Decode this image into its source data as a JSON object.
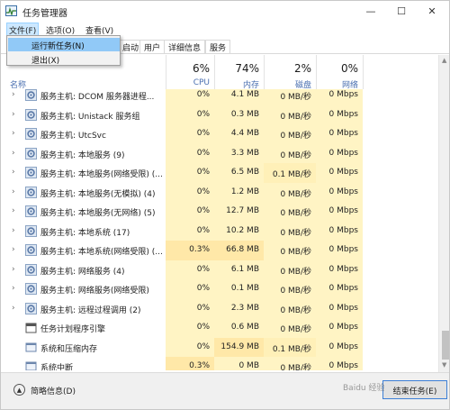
{
  "window": {
    "title": "任务管理器",
    "controls": {
      "minimize": "—",
      "maximize": "☐",
      "close": "✕"
    }
  },
  "menubar": {
    "file": "文件(F)",
    "options": "选项(O)",
    "view": "查看(V)"
  },
  "file_menu": {
    "items": [
      {
        "label": "运行新任务(N)",
        "highlighted": true
      },
      {
        "label": "退出(X)",
        "highlighted": false
      }
    ]
  },
  "tabs": [
    "启动",
    "用户",
    "详细信息",
    "服务"
  ],
  "columns": {
    "name": "名称",
    "cpu": {
      "pct": "6%",
      "label": "CPU"
    },
    "memory": {
      "pct": "74%",
      "label": "内存"
    },
    "disk": {
      "pct": "2%",
      "label": "磁盘"
    },
    "network": {
      "pct": "0%",
      "label": "网络"
    }
  },
  "rows": [
    {
      "name": "服务主机: DCOM 服务器进程...",
      "expand": true,
      "icon": "gear-icon",
      "cpu": "0%",
      "mem": "4.1 MB",
      "disk": "0 MB/秒",
      "net": "0 Mbps"
    },
    {
      "name": "服务主机: Unistack 服务组",
      "expand": true,
      "icon": "gear-icon",
      "cpu": "0%",
      "mem": "0.3 MB",
      "disk": "0 MB/秒",
      "net": "0 Mbps"
    },
    {
      "name": "服务主机: UtcSvc",
      "expand": true,
      "icon": "gear-icon",
      "cpu": "0%",
      "mem": "4.4 MB",
      "disk": "0 MB/秒",
      "net": "0 Mbps"
    },
    {
      "name": "服务主机: 本地服务 (9)",
      "expand": true,
      "icon": "gear-icon",
      "cpu": "0%",
      "mem": "3.3 MB",
      "disk": "0 MB/秒",
      "net": "0 Mbps"
    },
    {
      "name": "服务主机: 本地服务(网络受限) (...",
      "expand": true,
      "icon": "gear-icon",
      "cpu": "0%",
      "mem": "6.5 MB",
      "disk": "0.1 MB/秒",
      "net": "0 Mbps"
    },
    {
      "name": "服务主机: 本地服务(无模拟) (4)",
      "expand": true,
      "icon": "gear-icon",
      "cpu": "0%",
      "mem": "1.2 MB",
      "disk": "0 MB/秒",
      "net": "0 Mbps"
    },
    {
      "name": "服务主机: 本地服务(无网络) (5)",
      "expand": true,
      "icon": "gear-icon",
      "cpu": "0%",
      "mem": "12.7 MB",
      "disk": "0 MB/秒",
      "net": "0 Mbps"
    },
    {
      "name": "服务主机: 本地系统 (17)",
      "expand": true,
      "icon": "gear-icon",
      "cpu": "0%",
      "mem": "10.2 MB",
      "disk": "0 MB/秒",
      "net": "0 Mbps"
    },
    {
      "name": "服务主机: 本地系统(网络受限) (...",
      "expand": true,
      "icon": "gear-icon",
      "cpu": "0.3%",
      "mem": "66.8 MB",
      "disk": "0 MB/秒",
      "net": "0 Mbps"
    },
    {
      "name": "服务主机: 网络服务 (4)",
      "expand": true,
      "icon": "gear-icon",
      "cpu": "0%",
      "mem": "6.1 MB",
      "disk": "0 MB/秒",
      "net": "0 Mbps"
    },
    {
      "name": "服务主机: 网络服务(网络受限)",
      "expand": true,
      "icon": "gear-icon",
      "cpu": "0%",
      "mem": "0.1 MB",
      "disk": "0 MB/秒",
      "net": "0 Mbps"
    },
    {
      "name": "服务主机: 远程过程调用 (2)",
      "expand": true,
      "icon": "gear-icon",
      "cpu": "0%",
      "mem": "2.3 MB",
      "disk": "0 MB/秒",
      "net": "0 Mbps"
    },
    {
      "name": "任务计划程序引擎",
      "expand": false,
      "icon": "scheduler-icon",
      "cpu": "0%",
      "mem": "0.6 MB",
      "disk": "0 MB/秒",
      "net": "0 Mbps"
    },
    {
      "name": "系统和压缩内存",
      "expand": false,
      "icon": "window-icon",
      "cpu": "0%",
      "mem": "154.9 MB",
      "disk": "0.1 MB/秒",
      "net": "0 Mbps"
    },
    {
      "name": "系统中断",
      "expand": false,
      "icon": "window-icon",
      "cpu": "0.3%",
      "mem": "0 MB",
      "disk": "0 MB/秒",
      "net": "0 Mbps"
    }
  ],
  "footer": {
    "fewer_details": "简略信息(D)",
    "end_task": "结束任务(E)"
  },
  "watermark": "Baidu 经验"
}
